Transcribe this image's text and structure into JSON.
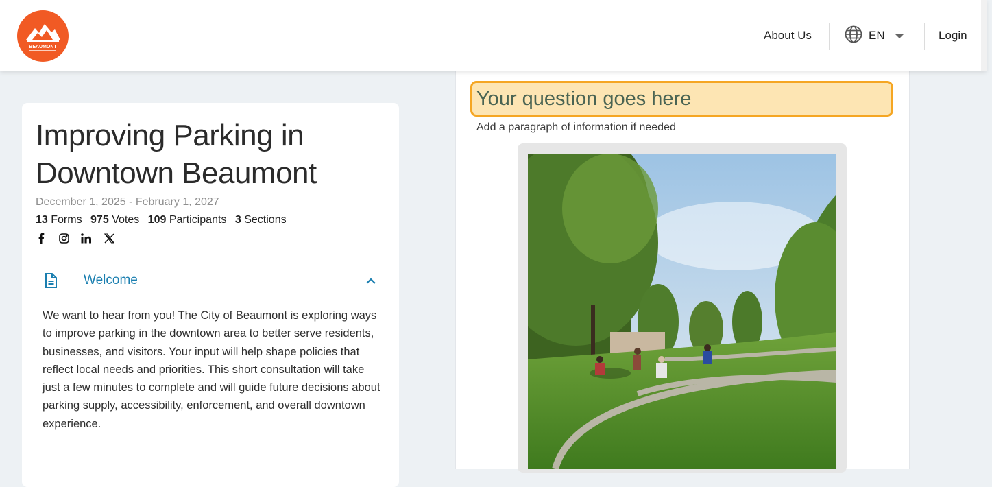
{
  "header": {
    "logo_text": "BEAUMONT",
    "nav": {
      "about_label": "About Us",
      "language_label": "EN",
      "login_label": "Login"
    }
  },
  "consultation": {
    "title": "Improving Parking in Downtown Beaumont",
    "dates": "December 1, 2025 - February 1, 2027",
    "stats": {
      "forms_count": "13",
      "forms_label": "Forms",
      "votes_count": "975",
      "votes_label": "Votes",
      "participants_count": "109",
      "participants_label": "Participants",
      "sections_count": "3",
      "sections_label": "Sections"
    },
    "social_icons": [
      "facebook-icon",
      "instagram-icon",
      "linkedin-icon",
      "x-icon"
    ],
    "section": {
      "label": "Welcome",
      "body": "We want to hear from you! The City of Beaumont is exploring ways to improve parking in the downtown area to better serve residents, businesses, and visitors. Your input will help shape policies that reflect local needs and priorities. This short consultation will take just a few minutes to complete and will guide future decisions about parking supply, accessibility, enforcement, and overall downtown experience."
    }
  },
  "question": {
    "title": "Your question goes here",
    "paragraph": "Add a paragraph of information if needed"
  },
  "colors": {
    "brand": "#f15a24",
    "link": "#1b7fb0",
    "question_bg": "#fde5b3",
    "question_border": "#f5a623",
    "question_text": "#4a6453"
  }
}
